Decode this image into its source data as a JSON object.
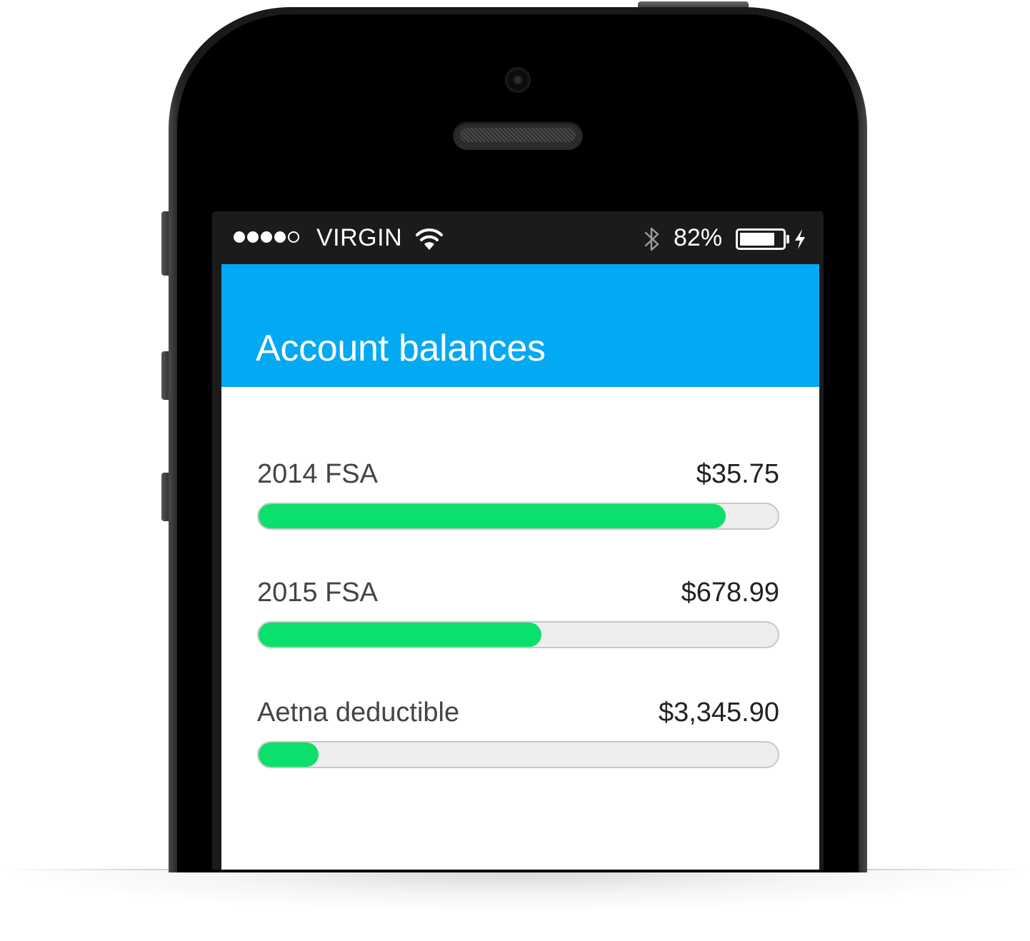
{
  "status_bar": {
    "signal_bars": [
      true,
      true,
      true,
      true,
      false
    ],
    "carrier": "VIRGIN",
    "battery_percent_label": "82%",
    "battery_level": 0.82,
    "icons": [
      "wifi-icon",
      "bluetooth-icon",
      "battery-icon",
      "charging-bolt-icon"
    ]
  },
  "header": {
    "title": "Account balances",
    "background_color": "#04a9f4"
  },
  "accounts": [
    {
      "name": "2014 FSA",
      "amount": "$35.75",
      "progress": 0.9
    },
    {
      "name": "2015 FSA",
      "amount": "$678.99",
      "progress": 0.545
    },
    {
      "name": "Aetna deductible",
      "amount": "$3,345.90",
      "progress": 0.115
    }
  ],
  "colors": {
    "progress_fill": "#0ae06b",
    "progress_track": "#eeeeee",
    "header": "#04a9f4"
  }
}
